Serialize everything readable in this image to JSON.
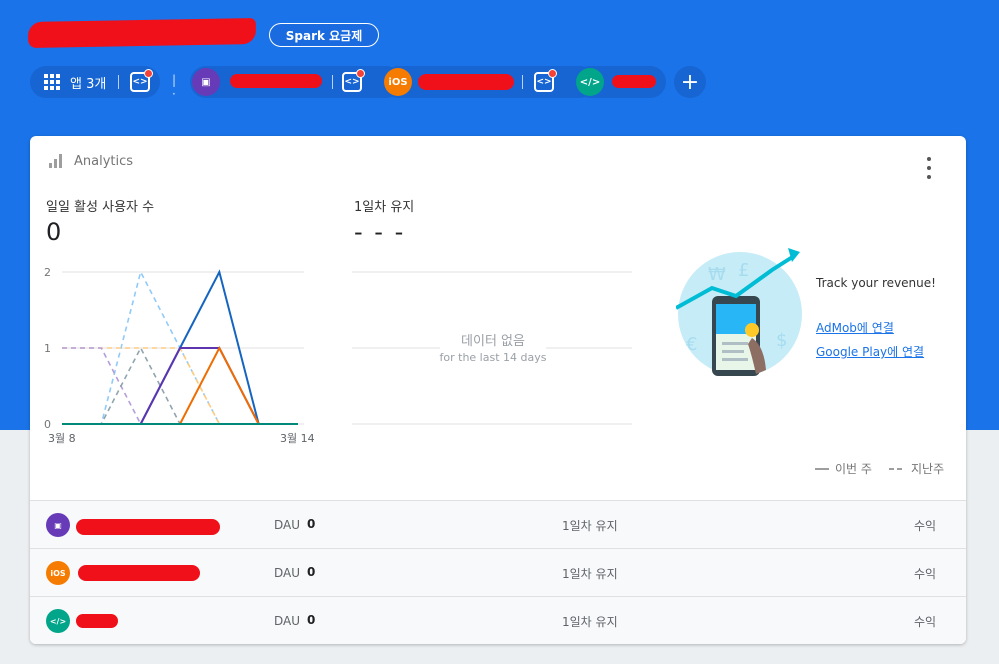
{
  "header": {
    "plan_badge": "Spark 요금제",
    "apps_chip_label": "앱 3개"
  },
  "apps": [
    {
      "platform": "android",
      "color": "#673ab7",
      "icon": "android-icon"
    },
    {
      "platform": "ios",
      "color": "#f57c00",
      "icon_text": "iOS"
    },
    {
      "platform": "web",
      "color": "#00a58a",
      "icon": "code-icon"
    }
  ],
  "analytics": {
    "title": "Analytics",
    "dau_label": "일일 활성 사용자 수",
    "dau_value": "0",
    "retention_label": "1일차 유지",
    "retention_value": "- - -",
    "no_data_title": "데이터 없음",
    "no_data_sub": "for the last 14 days",
    "legend_this_week": "이번 주",
    "legend_last_week": "지난주"
  },
  "promo": {
    "headline": "Track your revenue!",
    "admob_link": "AdMob에 연결",
    "play_link": "Google Play에 연결"
  },
  "rows": [
    {
      "dau_label": "DAU",
      "dau_value": "0",
      "retention": "1일차 유지",
      "revenue": "수익"
    },
    {
      "dau_label": "DAU",
      "dau_value": "0",
      "retention": "1일차 유지",
      "revenue": "수익"
    },
    {
      "dau_label": "DAU",
      "dau_value": "0",
      "retention": "1일차 유지",
      "revenue": "수익"
    }
  ],
  "chart_data": {
    "type": "line",
    "x_tick_labels": [
      "3월 8",
      "3월 14"
    ],
    "y_ticks": [
      0,
      1,
      2
    ],
    "ylim": [
      0,
      2
    ],
    "x": [
      1,
      2,
      3,
      4,
      5,
      6,
      7
    ],
    "series": [
      {
        "style": "solid",
        "color": "#1565c0",
        "values": [
          0,
          0,
          0,
          1,
          2,
          0,
          0
        ]
      },
      {
        "style": "solid",
        "color": "#5e35b1",
        "values": [
          0,
          0,
          0,
          1,
          1,
          0,
          0
        ]
      },
      {
        "style": "solid",
        "color": "#ef6c00",
        "values": [
          0,
          0,
          0,
          0,
          1,
          0,
          0
        ]
      },
      {
        "style": "solid",
        "color": "#00897b",
        "values": [
          0,
          0,
          0,
          0,
          0,
          0,
          0
        ]
      },
      {
        "style": "dashed",
        "color": "#90caf9",
        "values": [
          0,
          0,
          2,
          1,
          0,
          0,
          0
        ]
      },
      {
        "style": "dashed",
        "color": "#ffcc80",
        "values": [
          1,
          1,
          1,
          1,
          0,
          0,
          0
        ]
      },
      {
        "style": "dashed",
        "color": "#b39ddb",
        "values": [
          1,
          1,
          0,
          0,
          0,
          0,
          0
        ]
      },
      {
        "style": "dashed",
        "color": "#90a4ae",
        "values": [
          0,
          0,
          1,
          0,
          0,
          0,
          0
        ]
      }
    ]
  }
}
